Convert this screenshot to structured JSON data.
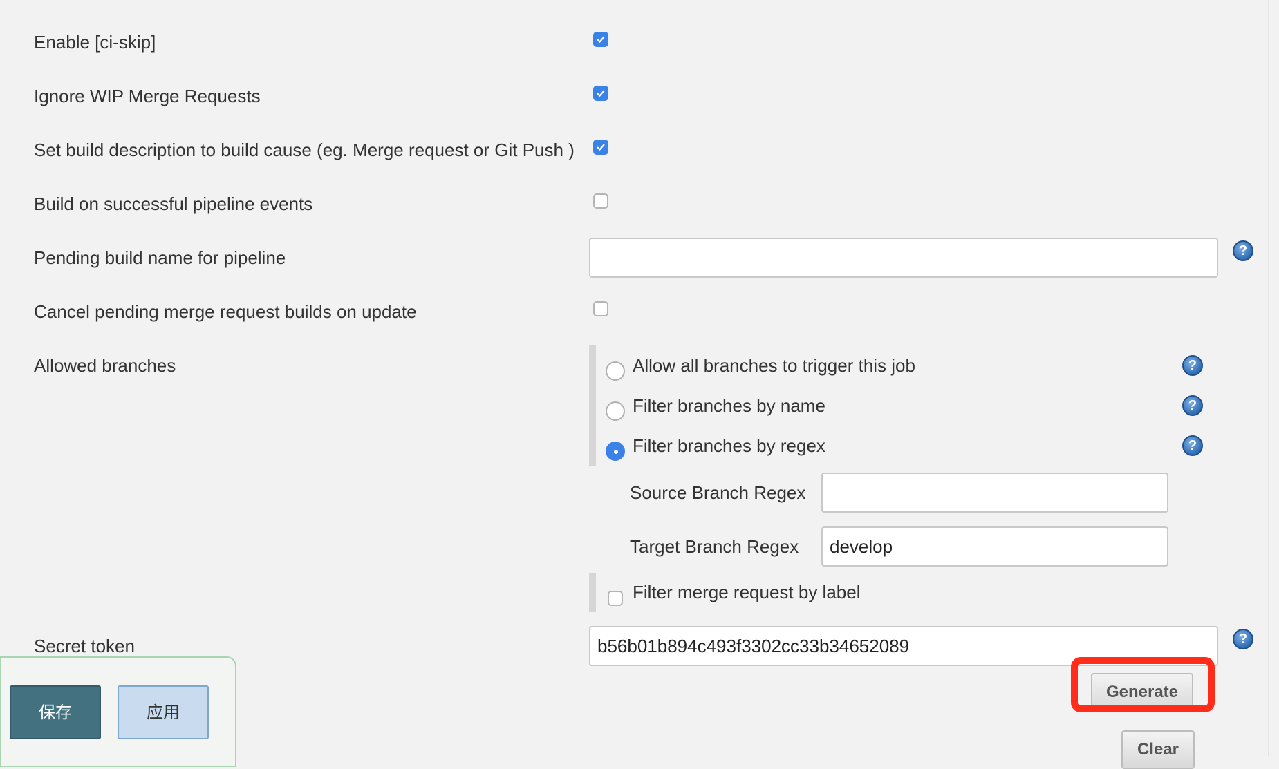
{
  "settings": {
    "ci_skip": {
      "label": "Enable [ci-skip]",
      "checked": true
    },
    "ignore_wip": {
      "label": "Ignore WIP Merge Requests",
      "checked": true
    },
    "build_description": {
      "label": "Set build description to build cause (eg. Merge request or Git Push )",
      "checked": true
    },
    "pipeline_events": {
      "label": "Build on successful pipeline events",
      "checked": false
    },
    "pending_build_name": {
      "label": "Pending build name for pipeline",
      "value": ""
    },
    "cancel_pending": {
      "label": "Cancel pending merge request builds on update",
      "checked": false
    }
  },
  "allowed_branches": {
    "label": "Allowed branches",
    "options": [
      {
        "label": "Allow all branches to trigger this job",
        "selected": false
      },
      {
        "label": "Filter branches by name",
        "selected": false
      },
      {
        "label": "Filter branches by regex",
        "selected": true
      }
    ],
    "source_regex": {
      "label": "Source Branch Regex",
      "value": ""
    },
    "target_regex": {
      "label": "Target Branch Regex",
      "value": "develop"
    },
    "filter_by_label": {
      "label": "Filter merge request by label",
      "checked": false
    }
  },
  "secret_token": {
    "label": "Secret token",
    "value": "b56b01b894c493f3302cc33b34652089",
    "generate_label": "Generate",
    "clear_label": "Clear"
  },
  "help_icon": "?",
  "footer": {
    "save_label": "保存",
    "apply_label": "应用"
  },
  "colors": {
    "accent": "#3b82e6",
    "highlight": "#ff2d1a",
    "save": "#43717f",
    "apply": "#c9dcef"
  }
}
